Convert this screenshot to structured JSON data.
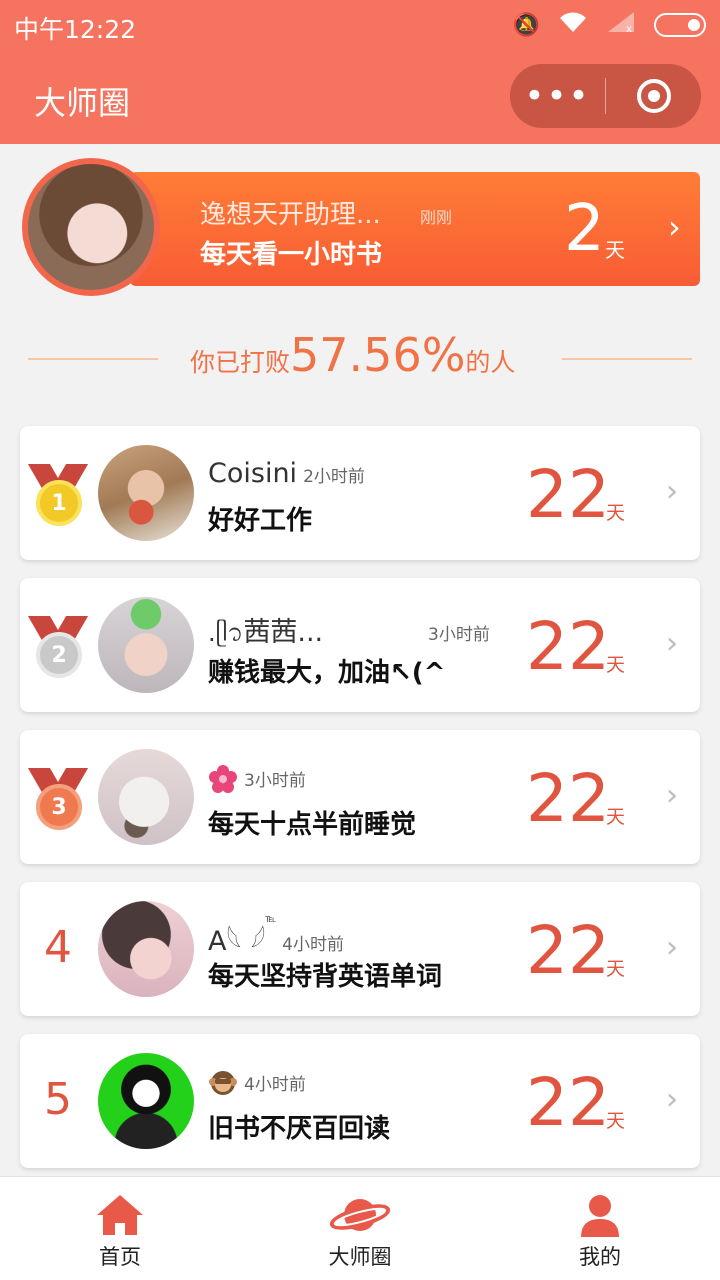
{
  "status": {
    "time": "中午12:22"
  },
  "nav": {
    "title": "大师圈",
    "more_label": "•••"
  },
  "me": {
    "name": "逸想天开助理...",
    "ago": "刚刚",
    "goal": "每天看一小时书",
    "days": "2",
    "unit": "天"
  },
  "defeat": {
    "prefix": "你已打败",
    "percent": "57.56%",
    "suffix": "的人"
  },
  "ranks": [
    {
      "rank": "1",
      "name": "Coisini",
      "ago": "2小时前",
      "goal": "好好工作",
      "days": "22",
      "unit": "天"
    },
    {
      "rank": "2",
      "name": "茜茜...",
      "ago": "3小时前",
      "goal": "赚钱最大，加油↖(^",
      "days": "22",
      "unit": "天"
    },
    {
      "rank": "3",
      "name": "",
      "ago": "3小时前",
      "goal": "每天十点半前睡觉",
      "days": "22",
      "unit": "天"
    },
    {
      "rank": "4",
      "name": "A𓆩 𓆪",
      "ago": "4小时前",
      "goal": "每天坚持背英语单词",
      "days": "22",
      "unit": "天"
    },
    {
      "rank": "5",
      "name": "",
      "ago": "4小时前",
      "goal": "旧书不厌百回读",
      "days": "22",
      "unit": "天"
    }
  ],
  "tabs": [
    {
      "label": "首页",
      "icon": "home-icon"
    },
    {
      "label": "大师圈",
      "icon": "planet-icon"
    },
    {
      "label": "我的",
      "icon": "person-icon"
    }
  ],
  "colors": {
    "brand": "#f5735f",
    "accent": "#e0553f",
    "card_gradient_top": "#ff7d36",
    "card_gradient_bottom": "#f85c35"
  }
}
